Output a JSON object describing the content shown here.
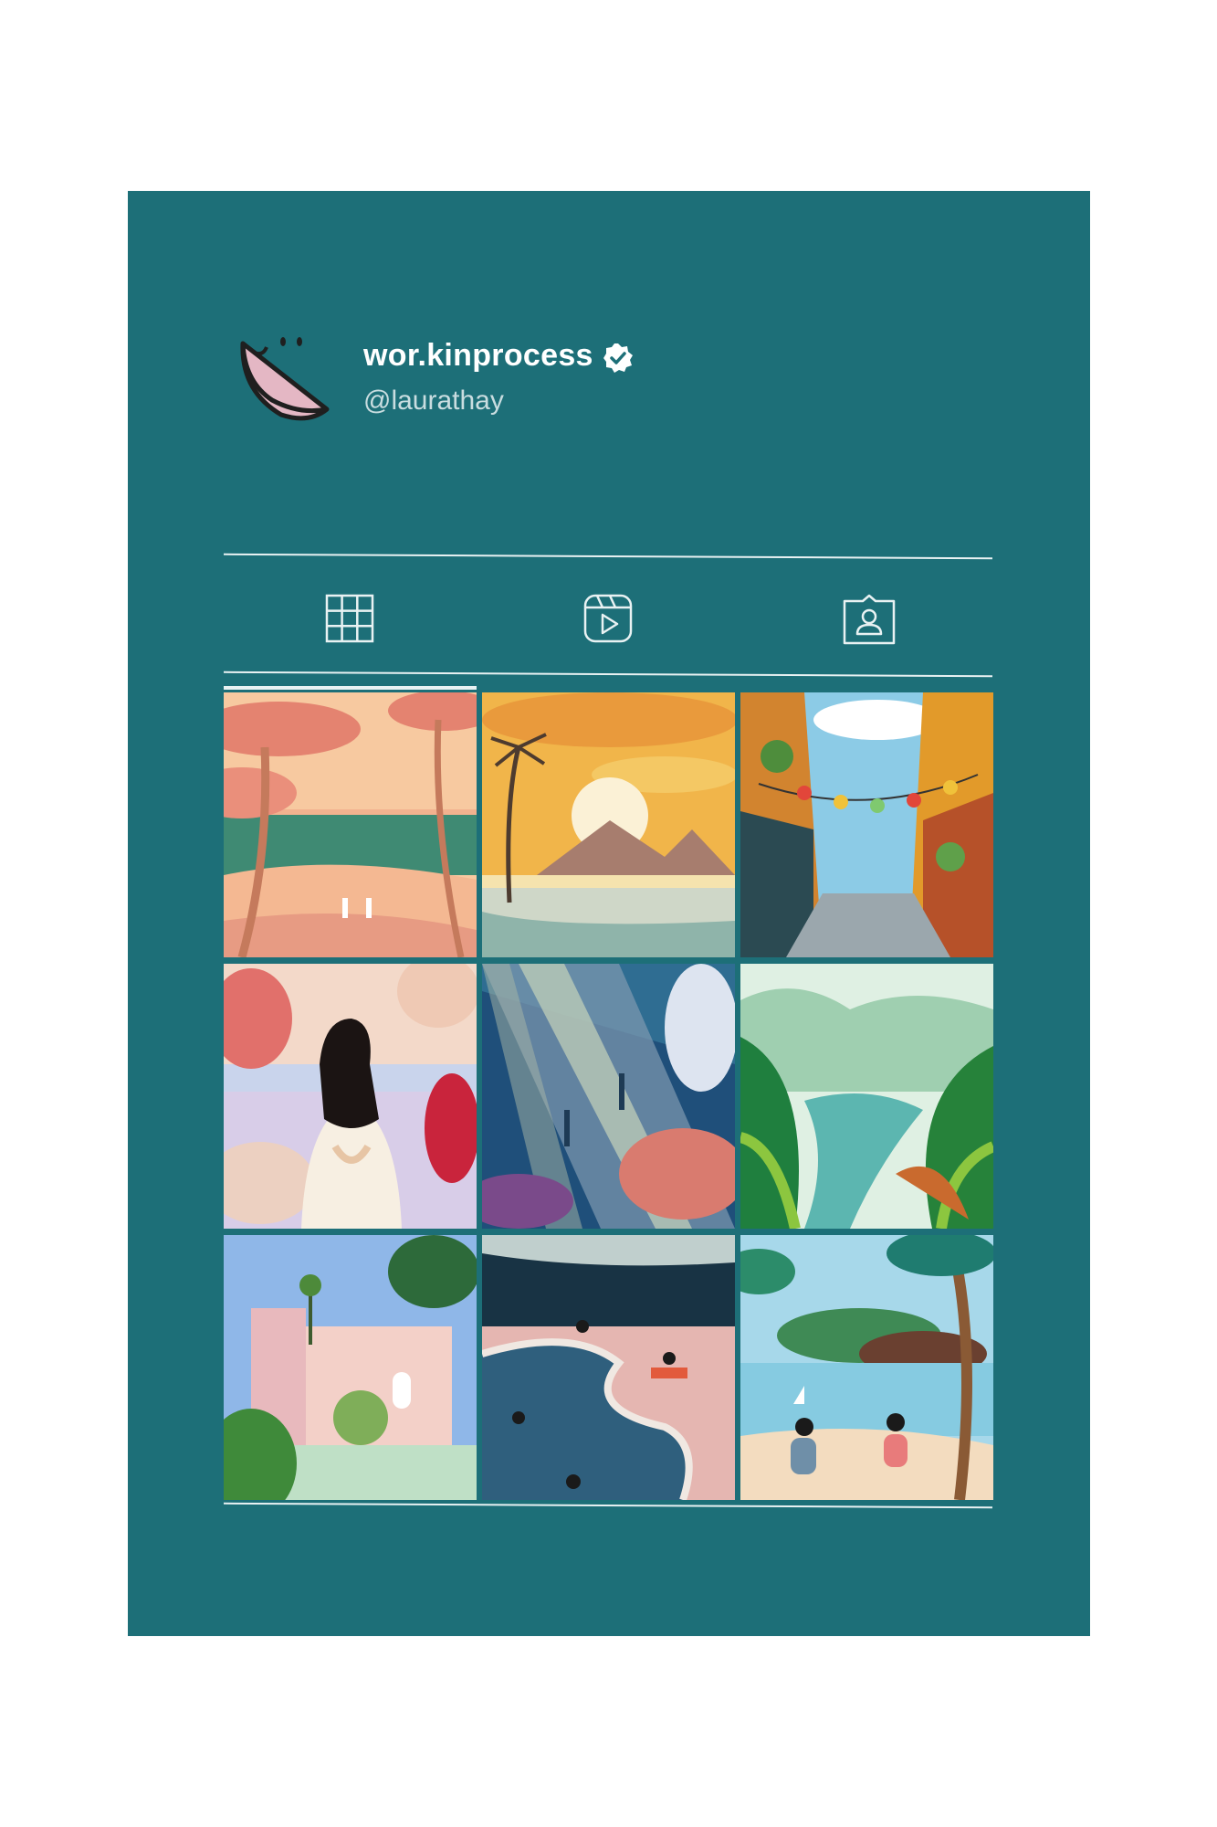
{
  "profile": {
    "username": "wor.kinprocess",
    "handle": "@laurathay",
    "verified": true,
    "avatar_icon": "watermelon-slice-icon"
  },
  "tabs": [
    {
      "name": "posts",
      "icon": "grid-icon",
      "active": true
    },
    {
      "name": "reels",
      "icon": "reels-icon",
      "active": false
    },
    {
      "name": "tagged",
      "icon": "tagged-person-icon",
      "active": false
    }
  ],
  "posts": [
    {
      "subject": "beach surfers pink trees"
    },
    {
      "subject": "tropical sunset mountains"
    },
    {
      "subject": "lantern street"
    },
    {
      "subject": "woman with monstera leaves"
    },
    {
      "subject": "underwater divers coral"
    },
    {
      "subject": "rice terraces valley"
    },
    {
      "subject": "pink courtyard plants"
    },
    {
      "subject": "swimming pool tiles"
    },
    {
      "subject": "women on beach palms"
    }
  ],
  "colors": {
    "background": "#1d6f78",
    "page": "#ffffff",
    "accent": "#e9f2f3"
  }
}
